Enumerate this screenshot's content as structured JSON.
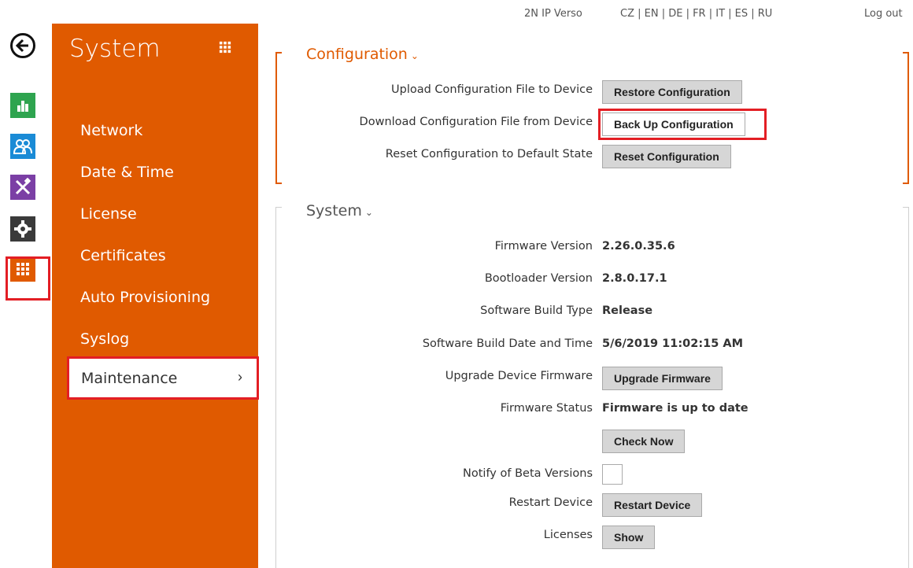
{
  "topbar": {
    "device_name": "2N IP Verso",
    "languages": "CZ | EN | DE | FR | IT | ES | RU",
    "logout": "Log out"
  },
  "rail": {
    "icons": [
      "back-arrow-icon",
      "status-chart-icon",
      "users-icon",
      "services-tools-icon",
      "hardware-gear-icon",
      "system-grid-icon"
    ]
  },
  "sidebar": {
    "title": "System",
    "items": [
      {
        "label": "Network"
      },
      {
        "label": "Date & Time"
      },
      {
        "label": "License"
      },
      {
        "label": "Certificates"
      },
      {
        "label": "Auto Provisioning"
      },
      {
        "label": "Syslog"
      },
      {
        "label": "Maintenance"
      }
    ],
    "active_chevron": "›"
  },
  "configuration": {
    "title": "Configuration",
    "caret": "⌄",
    "rows": [
      {
        "label": "Upload Configuration File to Device",
        "button": "Restore Configuration"
      },
      {
        "label": "Download Configuration File from Device",
        "button": "Back Up Configuration"
      },
      {
        "label": "Reset Configuration to Default State",
        "button": "Reset Configuration"
      }
    ]
  },
  "system": {
    "title": "System",
    "caret": "⌄",
    "firmware_version_label": "Firmware Version",
    "firmware_version": "2.26.0.35.6",
    "bootloader_version_label": "Bootloader Version",
    "bootloader_version": "2.8.0.17.1",
    "build_type_label": "Software Build Type",
    "build_type": "Release",
    "build_date_label": "Software Build Date and Time",
    "build_date": "5/6/2019 11:02:15 AM",
    "upgrade_label": "Upgrade Device Firmware",
    "upgrade_button": "Upgrade Firmware",
    "firmware_status_label": "Firmware Status",
    "firmware_status": "Firmware is up to date",
    "check_now_button": "Check Now",
    "beta_label": "Notify of Beta Versions",
    "beta_checked": false,
    "restart_label": "Restart Device",
    "restart_button": "Restart Device",
    "licenses_label": "Licenses",
    "licenses_button": "Show"
  }
}
